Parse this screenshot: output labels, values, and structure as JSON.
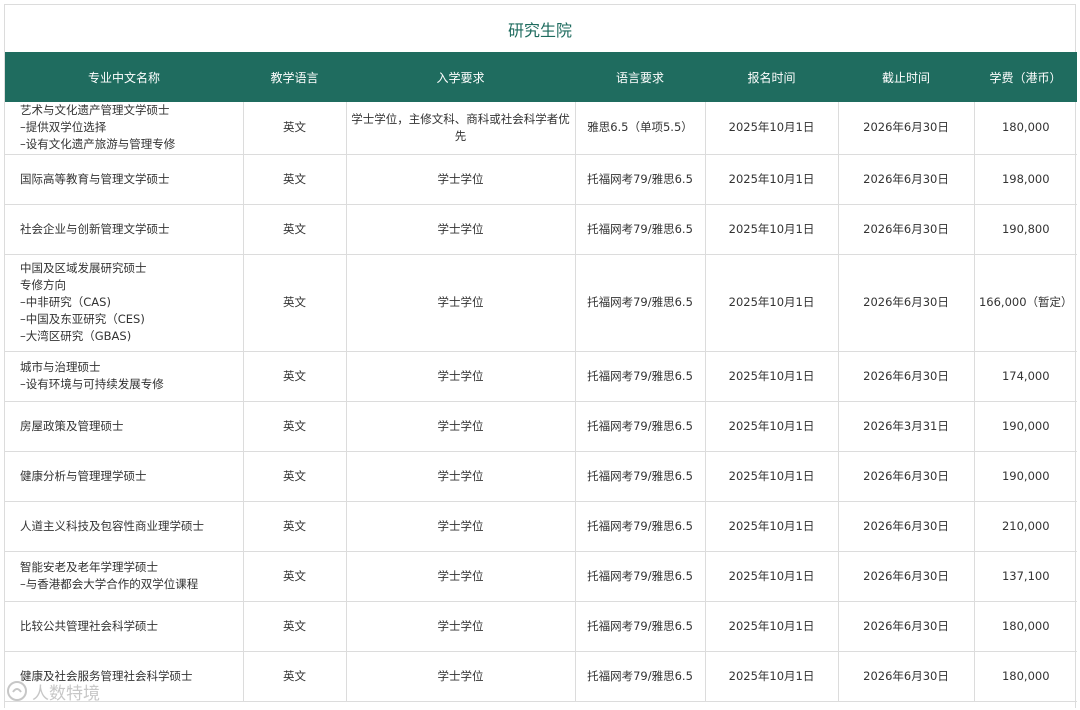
{
  "title": "研究生院",
  "headers": [
    "专业中文名称",
    "教学语言",
    "入学要求",
    "语言要求",
    "报名时间",
    "截止时间",
    "学费（港币）"
  ],
  "rows": [
    {
      "name": [
        "艺术与文化遗产管理文学硕士",
        "–提供双学位选择",
        "–设有文化遗产旅游与管理专修"
      ],
      "lang": "英文",
      "req": "学士学位，主修文科、商科或社会科学者优先",
      "lang_req": "雅思6.5（单项5.5）",
      "open": "2025年10月1日",
      "deadline": "2026年6月30日",
      "fee": "180,000"
    },
    {
      "name": [
        "国际高等教育与管理文学硕士"
      ],
      "lang": "英文",
      "req": "学士学位",
      "lang_req": "托福网考79/雅思6.5",
      "open": "2025年10月1日",
      "deadline": "2026年6月30日",
      "fee": "198,000"
    },
    {
      "name": [
        "社会企业与创新管理文学硕士"
      ],
      "lang": "英文",
      "req": "学士学位",
      "lang_req": "托福网考79/雅思6.5",
      "open": "2025年10月1日",
      "deadline": "2026年6月30日",
      "fee": "190,800"
    },
    {
      "name": [
        "中国及区域发展研究硕士",
        "专修方向",
        "–中非研究（CAS)",
        "–中国及东亚研究（CES)",
        "–大湾区研究（GBAS)"
      ],
      "lang": "英文",
      "req": "学士学位",
      "lang_req": "托福网考79/雅思6.5",
      "open": "2025年10月1日",
      "deadline": "2026年6月30日",
      "fee": "166,000（暂定）"
    },
    {
      "name": [
        "城市与治理硕士",
        "–设有环境与可持续发展专修"
      ],
      "lang": "英文",
      "req": "学士学位",
      "lang_req": "托福网考79/雅思6.5",
      "open": "2025年10月1日",
      "deadline": "2026年6月30日",
      "fee": "174,000"
    },
    {
      "name": [
        "房屋政策及管理硕士"
      ],
      "lang": "英文",
      "req": "学士学位",
      "lang_req": "托福网考79/雅思6.5",
      "open": "2025年10月1日",
      "deadline": "2026年3月31日",
      "fee": "190,000"
    },
    {
      "name": [
        "健康分析与管理理学硕士"
      ],
      "lang": "英文",
      "req": "学士学位",
      "lang_req": "托福网考79/雅思6.5",
      "open": "2025年10月1日",
      "deadline": "2026年6月30日",
      "fee": "190,000"
    },
    {
      "name": [
        "人道主义科技及包容性商业理学硕士"
      ],
      "lang": "英文",
      "req": "学士学位",
      "lang_req": "托福网考79/雅思6.5",
      "open": "2025年10月1日",
      "deadline": "2026年6月30日",
      "fee": "210,000"
    },
    {
      "name": [
        "智能安老及老年学理学硕士",
        "–与香港都会大学合作的双学位课程"
      ],
      "lang": "英文",
      "req": "学士学位",
      "lang_req": "托福网考79/雅思6.5",
      "open": "2025年10月1日",
      "deadline": "2026年6月30日",
      "fee": "137,100"
    },
    {
      "name": [
        "比较公共管理社会科学硕士"
      ],
      "lang": "英文",
      "req": "学士学位",
      "lang_req": "托福网考79/雅思6.5",
      "open": "2025年10月1日",
      "deadline": "2026年6月30日",
      "fee": "180,000"
    },
    {
      "name": [
        "健康及社会服务管理社会科学硕士"
      ],
      "lang": "英文",
      "req": "学士学位",
      "lang_req": "托福网考79/雅思6.5",
      "open": "2025年10月1日",
      "deadline": "2026年6月30日",
      "fee": "180,000"
    }
  ],
  "watermark": {
    "text": "人数特境",
    "icon": "watermark-logo-icon"
  }
}
